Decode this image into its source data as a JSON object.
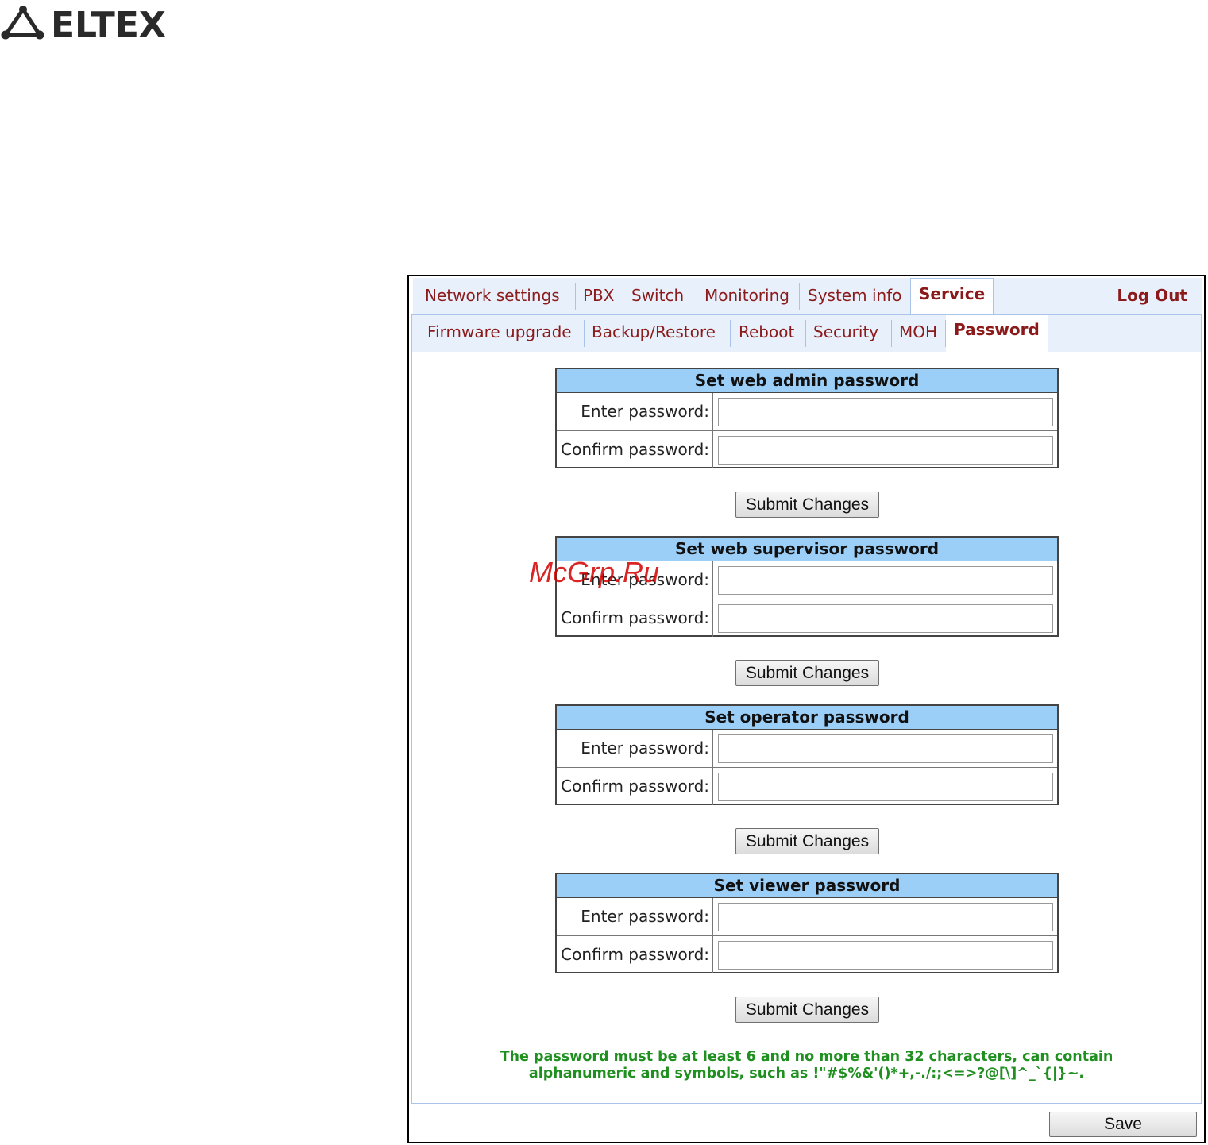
{
  "brand": {
    "name": "ELTEX"
  },
  "nav": {
    "tabs": [
      "Network settings",
      "PBX",
      "Switch",
      "Monitoring",
      "System info",
      "Service"
    ],
    "active": "Service",
    "logout": "Log Out"
  },
  "subnav": {
    "tabs": [
      "Firmware upgrade",
      "Backup/Restore",
      "Reboot",
      "Security",
      "MOH",
      "Password"
    ],
    "active": "Password"
  },
  "sections": [
    {
      "title": "Set web admin password",
      "enter_label": "Enter password:",
      "confirm_label": "Confirm password:",
      "enter_value": "",
      "confirm_value": "",
      "submit": "Submit Changes"
    },
    {
      "title": "Set web supervisor password",
      "enter_label": "Enter password:",
      "confirm_label": "Confirm password:",
      "enter_value": "",
      "confirm_value": "",
      "submit": "Submit Changes"
    },
    {
      "title": "Set operator password",
      "enter_label": "Enter password:",
      "confirm_label": "Confirm password:",
      "enter_value": "",
      "confirm_value": "",
      "submit": "Submit Changes"
    },
    {
      "title": "Set viewer password",
      "enter_label": "Enter password:",
      "confirm_label": "Confirm password:",
      "enter_value": "",
      "confirm_value": "",
      "submit": "Submit Changes"
    }
  ],
  "note": {
    "line1": "The password must be at least 6 and no more than 32 characters, can contain",
    "line2": "alphanumeric and symbols, such as !\"#$%&'()*+,-./:;<=>?@[\\]^_`{|}~."
  },
  "save_label": "Save",
  "watermark": "McGrp.Ru",
  "colors": {
    "tab_text": "#8b1a1a",
    "nav_bg": "#e8f0fb",
    "header_bg": "#9ccff7",
    "note_text": "#1f8f1f"
  }
}
